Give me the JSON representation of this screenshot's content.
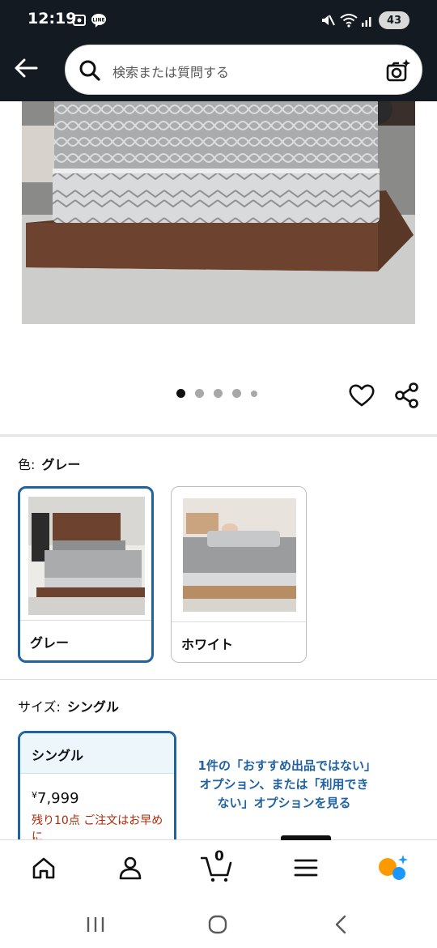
{
  "status_bar": {
    "time": "12:19",
    "battery": "43"
  },
  "search": {
    "placeholder": "検索または質問する"
  },
  "image_carousel": {
    "total_dots": 5,
    "active_index": 0
  },
  "color_option": {
    "label": "色:",
    "selected": "グレー",
    "choices": [
      {
        "name": "グレー",
        "selected": true
      },
      {
        "name": "ホワイト",
        "selected": false
      }
    ]
  },
  "size_option": {
    "label": "サイズ:",
    "selected": "シングル",
    "card": {
      "name": "シングル",
      "currency": "¥",
      "price": "7,999",
      "stock_note": "残り10点 ご注文はお早めに"
    },
    "other_offers_link": "1件の「おすすめ出品ではない」オプション、または「利用できない」オプションを見る"
  },
  "bottom_nav": {
    "items": [
      "home-icon",
      "account-icon",
      "cart-icon",
      "menu-icon",
      "rufus-icon"
    ],
    "cart_count": "0",
    "active_item": "menu-icon"
  },
  "colors": {
    "header_bg": "#131a22",
    "selected_border": "#2162a1",
    "link": "#2162a1",
    "stock_red": "#b12704",
    "ai_orange": "#ff9900",
    "ai_blue": "#1a98ff"
  }
}
